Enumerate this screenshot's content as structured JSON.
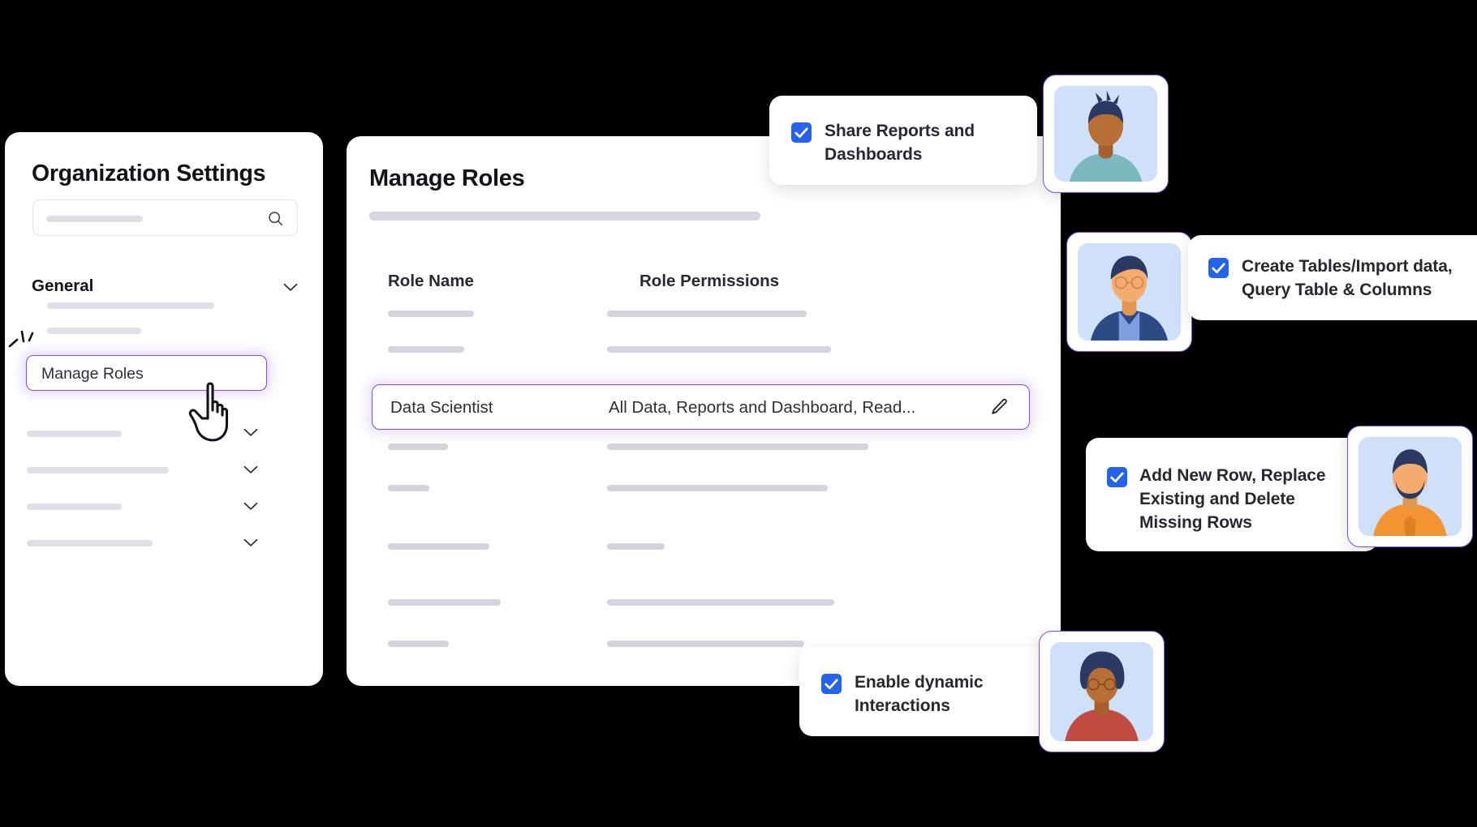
{
  "sidebar": {
    "title": "Organization Settings",
    "search": {
      "name": "search-input",
      "placeholder": "",
      "value": "",
      "icon": "search-icon"
    },
    "section_general": {
      "label": "General",
      "chevron": "chevron-down-icon"
    },
    "selected_item": {
      "label": "Manage Roles",
      "accent": "#7c4dea"
    },
    "collapsed_sections": [
      {
        "label": "",
        "chevron": "chevron-down-icon"
      },
      {
        "label": "",
        "chevron": "chevron-down-icon"
      },
      {
        "label": "",
        "chevron": "chevron-down-icon"
      },
      {
        "label": "",
        "chevron": "chevron-down-icon"
      }
    ],
    "cursor": "pointing-hand-cursor"
  },
  "main": {
    "title": "Manage Roles",
    "columns": {
      "role_name": "Role Name",
      "role_permissions": "Role Permissions"
    },
    "selected_row": {
      "role_name": "Data Scientist",
      "role_permissions": "All Data, Reports and Dashboard, Read...",
      "edit_icon": "pencil-edit-icon",
      "accent": "#7c4dea"
    }
  },
  "callouts": [
    {
      "id": "share-reports",
      "text": "Share Reports and Dashboards",
      "checked": true,
      "checkbox_color": "#2563eb",
      "avatar": "avatar-teal-shirt"
    },
    {
      "id": "create-tables",
      "text": "Create Tables/Import data, Query Table & Columns",
      "checked": true,
      "checkbox_color": "#2563eb",
      "avatar": "avatar-glasses-blue-shirt"
    },
    {
      "id": "add-new-row",
      "text": "Add New Row, Replace Existing and Delete Missing Rows",
      "checked": true,
      "checkbox_color": "#2563eb",
      "avatar": "avatar-beard-orange-shirt"
    },
    {
      "id": "enable-dynamic",
      "text": "Enable dynamic Interactions",
      "checked": true,
      "checkbox_color": "#2563eb",
      "avatar": "avatar-afro-red-shirt"
    }
  ],
  "theme": {
    "accent_purple": "#7c4dea",
    "checkbox_blue": "#2563eb",
    "skeleton_gray": "#dfe0e5",
    "background": "#000000"
  }
}
